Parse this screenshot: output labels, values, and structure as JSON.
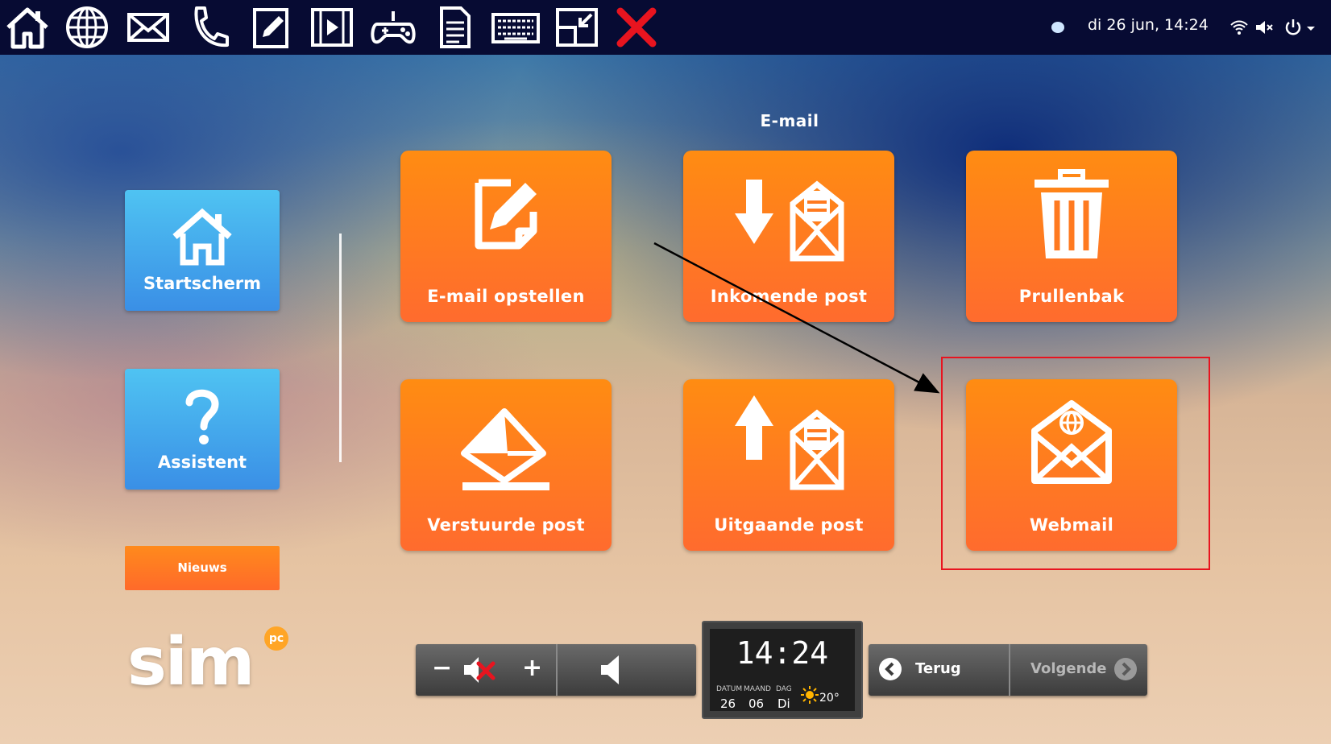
{
  "system_bar": {
    "icons": [
      "home-icon",
      "globe-icon",
      "mail-icon",
      "phone-icon",
      "notepad-icon",
      "video-icon",
      "gamepad-icon",
      "document-icon",
      "keyboard-icon",
      "minimize-window-icon",
      "close-icon"
    ],
    "datetime": "di 26 jun, 14:24"
  },
  "page": {
    "title": "E-mail"
  },
  "sidebar": {
    "home_label": "Startscherm",
    "assistant_label": "Assistent",
    "news_label": "Nieuws"
  },
  "logo": {
    "text": "sim",
    "badge": "pc"
  },
  "tiles": [
    {
      "label": "E-mail opstellen",
      "icon": "compose-icon"
    },
    {
      "label": "Inkomende post",
      "icon": "inbox-icon"
    },
    {
      "label": "Prullenbak",
      "icon": "trash-icon"
    },
    {
      "label": "Verstuurde post",
      "icon": "sent-icon"
    },
    {
      "label": "Uitgaande post",
      "icon": "outbox-icon"
    },
    {
      "label": "Webmail",
      "icon": "webmail-icon"
    }
  ],
  "bottom_bar": {
    "vol_minus": "−",
    "vol_plus": "+",
    "clock": {
      "time": "14:24",
      "date_label": "DATUM",
      "month_label": "MAAND",
      "day_label": "DAG",
      "date": "26",
      "month": "06",
      "day": "Di",
      "temperature": "20°"
    },
    "back_label": "Terug",
    "next_label": "Volgende"
  },
  "colors": {
    "tile_orange": "#ff7a20",
    "side_blue": "#3f9ae8",
    "highlight_red": "#e8141f",
    "topbar": "#070b33"
  }
}
